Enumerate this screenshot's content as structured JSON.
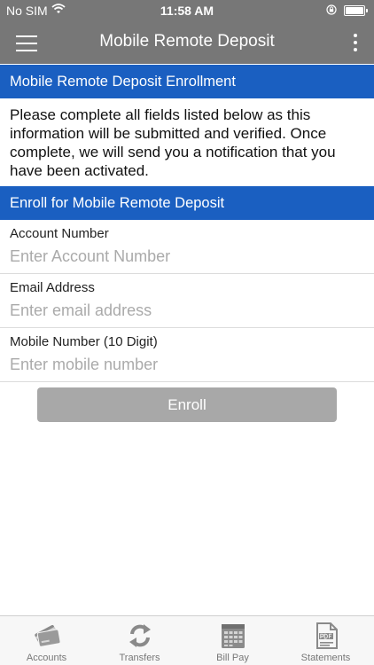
{
  "status_bar": {
    "carrier": "No SIM",
    "time": "11:58 AM"
  },
  "header": {
    "title": "Mobile Remote Deposit"
  },
  "enrollment": {
    "heading": "Mobile Remote Deposit Enrollment",
    "description": "Please complete all fields listed below as this information will be submitted and verified.  Once complete, we will send you a notification that you have been activated."
  },
  "form": {
    "heading": "Enroll for Mobile Remote Deposit",
    "fields": [
      {
        "label": "Account Number",
        "placeholder": "Enter Account Number",
        "value": ""
      },
      {
        "label": "Email Address",
        "placeholder": "Enter email address",
        "value": ""
      },
      {
        "label": "Mobile Number (10 Digit)",
        "placeholder": "Enter mobile number",
        "value": ""
      }
    ],
    "submit_label": "Enroll"
  },
  "tabs": [
    {
      "label": "Accounts",
      "icon": "accounts-icon"
    },
    {
      "label": "Transfers",
      "icon": "transfers-icon"
    },
    {
      "label": "Bill Pay",
      "icon": "bill-pay-icon"
    },
    {
      "label": "Statements",
      "icon": "statements-icon"
    }
  ],
  "colors": {
    "nav_bar": "#777777",
    "section_header": "#1a5fc1",
    "button_disabled": "#a8a8a8",
    "tab_icon": "#8a8a8a"
  }
}
